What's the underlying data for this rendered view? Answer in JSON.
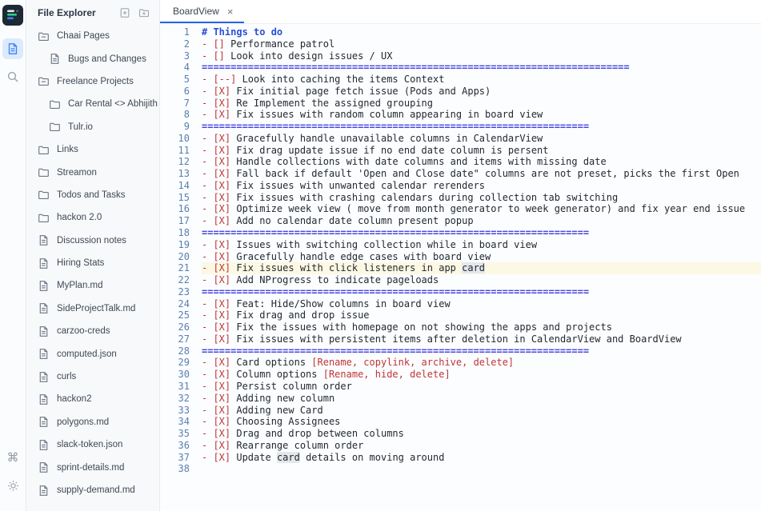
{
  "theme": {
    "accent": "#2563eb",
    "heading": "#2b50d8",
    "separator": "#4745e0",
    "todo_red": "#c13535",
    "line_number": "#5a7fae",
    "text": "#24292f",
    "current_line_bg": "#fcf8e3",
    "occurrence_bg": "#e4e7eb",
    "sidebar_bg": "#f7f9fb",
    "active_rail_bg": "#dceafd",
    "active_rail_icon": "#3b82f6",
    "logo_bars": [
      "#e8eaee",
      "#2ecc8f",
      "#3b82f6"
    ]
  },
  "rail": {
    "icons": [
      "app-logo",
      "file-explorer-icon",
      "search-icon",
      "command-icon",
      "settings-icon"
    ]
  },
  "sidebar": {
    "title": "File Explorer",
    "header_icons": [
      "new-file-icon",
      "new-folder-icon"
    ],
    "items": [
      {
        "label": "Chaai Pages",
        "type": "folder-open",
        "level": 0
      },
      {
        "label": "Bugs and Changes",
        "type": "file",
        "level": 1
      },
      {
        "label": "Freelance Projects",
        "type": "folder-open",
        "level": 0
      },
      {
        "label": "Car Rental <> Abhijith",
        "type": "folder",
        "level": 1
      },
      {
        "label": "Tulr.io",
        "type": "folder",
        "level": 1
      },
      {
        "label": "Links",
        "type": "folder",
        "level": 0
      },
      {
        "label": "Streamon",
        "type": "folder",
        "level": 0
      },
      {
        "label": "Todos and Tasks",
        "type": "folder",
        "level": 0
      },
      {
        "label": "hackon 2.0",
        "type": "folder",
        "level": 0
      },
      {
        "label": "Discussion notes",
        "type": "file",
        "level": 0
      },
      {
        "label": "Hiring Stats",
        "type": "file",
        "level": 0
      },
      {
        "label": "MyPlan.md",
        "type": "file",
        "level": 0
      },
      {
        "label": "SideProjectTalk.md",
        "type": "file",
        "level": 0
      },
      {
        "label": "carzoo-creds",
        "type": "file",
        "level": 0
      },
      {
        "label": "computed.json",
        "type": "file",
        "level": 0
      },
      {
        "label": "curls",
        "type": "file",
        "level": 0
      },
      {
        "label": "hackon2",
        "type": "file",
        "level": 0
      },
      {
        "label": "polygons.md",
        "type": "file",
        "level": 0
      },
      {
        "label": "slack-token.json",
        "type": "file",
        "level": 0
      },
      {
        "label": "sprint-details.md",
        "type": "file",
        "level": 0
      },
      {
        "label": "supply-demand.md",
        "type": "file",
        "level": 0
      }
    ]
  },
  "tabs": [
    {
      "label": "BoardView",
      "close": "×",
      "active": true
    }
  ],
  "editor": {
    "active_line": 21,
    "highlighted_word": "card",
    "lines": [
      {
        "n": 1,
        "tokens": [
          [
            "hd",
            "# Things to do"
          ]
        ]
      },
      {
        "n": 2,
        "tokens": [
          [
            "kw",
            "- [] "
          ],
          [
            "tx",
            "Performance patrol"
          ]
        ]
      },
      {
        "n": 3,
        "tokens": [
          [
            "kw",
            "- [] "
          ],
          [
            "tx",
            "Look into design issues / UX"
          ]
        ]
      },
      {
        "n": 4,
        "tokens": [
          [
            "sep",
            "=========================================================================="
          ]
        ]
      },
      {
        "n": 5,
        "tokens": [
          [
            "kw",
            "- [--] "
          ],
          [
            "tx",
            "Look into caching the items Context"
          ]
        ]
      },
      {
        "n": 6,
        "tokens": [
          [
            "kw",
            "- [X] "
          ],
          [
            "tx",
            "Fix initial page fetch issue (Pods and Apps)"
          ]
        ]
      },
      {
        "n": 7,
        "tokens": [
          [
            "kw",
            "- [X] "
          ],
          [
            "tx",
            "Re Implement the assigned grouping"
          ]
        ]
      },
      {
        "n": 8,
        "tokens": [
          [
            "kw",
            "- [X] "
          ],
          [
            "tx",
            "Fix issues with random column appearing in board view"
          ]
        ]
      },
      {
        "n": 9,
        "tokens": [
          [
            "sep",
            "==================================================================="
          ]
        ]
      },
      {
        "n": 10,
        "tokens": [
          [
            "kw",
            "- [X] "
          ],
          [
            "tx",
            "Gracefully handle unavailable columns in CalendarView"
          ]
        ]
      },
      {
        "n": 11,
        "tokens": [
          [
            "kw",
            "- [X] "
          ],
          [
            "tx",
            "Fix drag update issue if no end date column is persent"
          ]
        ]
      },
      {
        "n": 12,
        "tokens": [
          [
            "kw",
            "- [X] "
          ],
          [
            "tx",
            "Handle collections with date columns and items with missing date"
          ]
        ]
      },
      {
        "n": 13,
        "tokens": [
          [
            "kw",
            "- [X] "
          ],
          [
            "tx",
            "Fall back if default 'Open and Close date\" columns are not preset, picks the first Open"
          ]
        ]
      },
      {
        "n": 14,
        "tokens": [
          [
            "kw",
            "- [X] "
          ],
          [
            "tx",
            "Fix issues with unwanted calendar rerenders"
          ]
        ]
      },
      {
        "n": 15,
        "tokens": [
          [
            "kw",
            "- [X] "
          ],
          [
            "tx",
            "Fix issues with crashing calendars during collection tab switching"
          ]
        ]
      },
      {
        "n": 16,
        "tokens": [
          [
            "kw",
            "- [X] "
          ],
          [
            "tx",
            "Optimize week view ( move from month generator to week generator) and fix year end issue"
          ]
        ]
      },
      {
        "n": 17,
        "tokens": [
          [
            "kw",
            "- [X] "
          ],
          [
            "tx",
            "Add no calendar date column present popup"
          ]
        ]
      },
      {
        "n": 18,
        "tokens": [
          [
            "sep",
            "==================================================================="
          ]
        ]
      },
      {
        "n": 19,
        "tokens": [
          [
            "kw",
            "- [X] "
          ],
          [
            "tx",
            "Issues with switching collection while in board view"
          ]
        ]
      },
      {
        "n": 20,
        "tokens": [
          [
            "kw",
            "- [X] "
          ],
          [
            "tx",
            "Gracefully handle edge cases with board view"
          ]
        ]
      },
      {
        "n": 21,
        "tokens": [
          [
            "kw",
            "- [X] "
          ],
          [
            "tx",
            "Fix issues with click listeners in app "
          ],
          [
            "occ",
            "card"
          ]
        ]
      },
      {
        "n": 22,
        "tokens": [
          [
            "kw",
            "- [X] "
          ],
          [
            "tx",
            "Add NProgress to indicate pageloads"
          ]
        ]
      },
      {
        "n": 23,
        "tokens": [
          [
            "sep",
            "==================================================================="
          ]
        ]
      },
      {
        "n": 24,
        "tokens": [
          [
            "kw",
            "- [X] "
          ],
          [
            "tx",
            "Feat: Hide/Show columns in board view"
          ]
        ]
      },
      {
        "n": 25,
        "tokens": [
          [
            "kw",
            "- [X] "
          ],
          [
            "tx",
            "Fix drag and drop issue"
          ]
        ]
      },
      {
        "n": 26,
        "tokens": [
          [
            "kw",
            "- [X] "
          ],
          [
            "tx",
            "Fix the issues with homepage on not showing the apps and projects"
          ]
        ]
      },
      {
        "n": 27,
        "tokens": [
          [
            "kw",
            "- [X] "
          ],
          [
            "tx",
            "Fix issues with persistent items after deletion in CalendarView and BoardView"
          ]
        ]
      },
      {
        "n": 28,
        "tokens": [
          [
            "sep",
            "==================================================================="
          ]
        ]
      },
      {
        "n": 29,
        "tokens": [
          [
            "kw",
            "- [X] "
          ],
          [
            "tx",
            "Card options "
          ],
          [
            "kw",
            "[Rename, copylink, archive, delete]"
          ]
        ]
      },
      {
        "n": 30,
        "tokens": [
          [
            "kw",
            "- [X] "
          ],
          [
            "tx",
            "Column options "
          ],
          [
            "kw",
            "[Rename, hide, delete]"
          ]
        ]
      },
      {
        "n": 31,
        "tokens": [
          [
            "kw",
            "- [X] "
          ],
          [
            "tx",
            "Persist column order"
          ]
        ]
      },
      {
        "n": 32,
        "tokens": [
          [
            "kw",
            "- [X] "
          ],
          [
            "tx",
            "Adding new column"
          ]
        ]
      },
      {
        "n": 33,
        "tokens": [
          [
            "kw",
            "- [X] "
          ],
          [
            "tx",
            "Adding new Card"
          ]
        ]
      },
      {
        "n": 34,
        "tokens": [
          [
            "kw",
            "- [X] "
          ],
          [
            "tx",
            "Choosing Assignees"
          ]
        ]
      },
      {
        "n": 35,
        "tokens": [
          [
            "kw",
            "- [X] "
          ],
          [
            "tx",
            "Drag and drop between columns"
          ]
        ]
      },
      {
        "n": 36,
        "tokens": [
          [
            "kw",
            "- [X] "
          ],
          [
            "tx",
            "Rearrange column order"
          ]
        ]
      },
      {
        "n": 37,
        "tokens": [
          [
            "kw",
            "- [X] "
          ],
          [
            "tx",
            "Update "
          ],
          [
            "occ",
            "card"
          ],
          [
            "tx",
            " details on moving around"
          ]
        ]
      },
      {
        "n": 38,
        "tokens": []
      }
    ]
  }
}
